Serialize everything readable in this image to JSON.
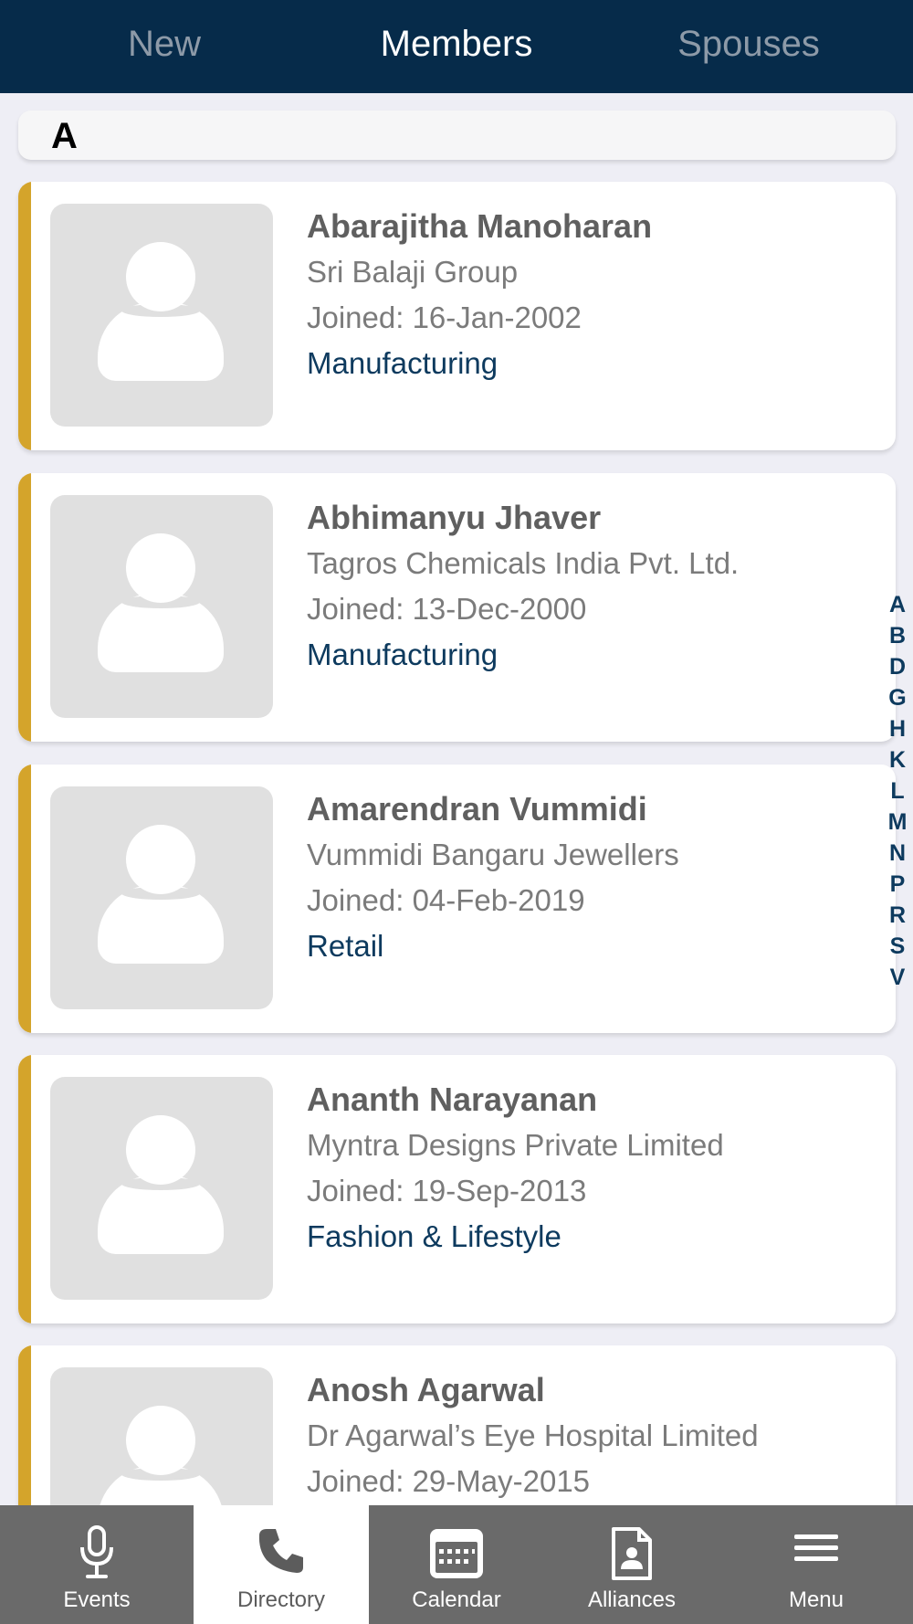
{
  "tabs": {
    "new": "New",
    "members": "Members",
    "spouses": "Spouses"
  },
  "section": {
    "letter": "A"
  },
  "members": [
    {
      "name": "Abarajitha Manoharan",
      "company": "Sri Balaji Group",
      "joined": "Joined: 16-Jan-2002",
      "industry": "Manufacturing"
    },
    {
      "name": "Abhimanyu Jhaver",
      "company": "Tagros Chemicals India Pvt. Ltd.",
      "joined": "Joined: 13-Dec-2000",
      "industry": "Manufacturing"
    },
    {
      "name": "Amarendran Vummidi",
      "company": "Vummidi Bangaru Jewellers",
      "joined": "Joined: 04-Feb-2019",
      "industry": "Retail"
    },
    {
      "name": "Ananth Narayanan",
      "company": "Myntra Designs Private Limited",
      "joined": "Joined: 19-Sep-2013",
      "industry": "Fashion & Lifestyle"
    },
    {
      "name": "Anosh Agarwal",
      "company": "Dr Agarwal’s Eye Hospital Limited",
      "joined": "Joined: 29-May-2015",
      "industry": ""
    }
  ],
  "alpha_index": [
    "A",
    "B",
    "D",
    "G",
    "H",
    "K",
    "L",
    "M",
    "N",
    "P",
    "R",
    "S",
    "V"
  ],
  "bottom_nav": {
    "events": "Events",
    "directory": "Directory",
    "calendar": "Calendar",
    "alliances": "Alliances",
    "menu": "Menu"
  },
  "colors": {
    "header_bg": "#062b4a",
    "accent_bar": "#d4a42b",
    "industry_text": "#0d3a5e",
    "nav_bg": "#6a6a6a"
  },
  "icons": {
    "events": "microphone-icon",
    "directory": "phone-icon",
    "calendar": "calendar-icon",
    "alliances": "document-person-icon",
    "menu": "hamburger-icon"
  }
}
